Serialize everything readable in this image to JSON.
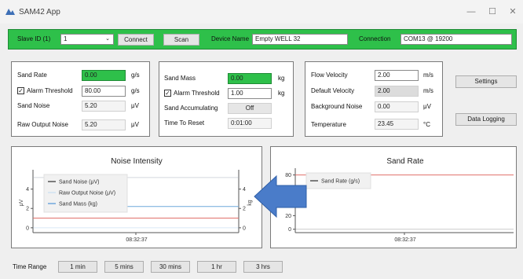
{
  "app": {
    "title": "SAM42 App",
    "window_controls": {
      "minimize": "—",
      "maximize": "☐",
      "close": "✕"
    }
  },
  "connection_bar": {
    "slave_id_label": "Slave ID (1)",
    "slave_id_value": "1",
    "connect_label": "Connect",
    "scan_label": "Scan",
    "device_name_label": "Device Name",
    "device_name_value": "Empty WELL 32",
    "connection_label": "Connection",
    "connection_value": "COM13 @ 19200",
    "accent_color": "#2ec04a"
  },
  "group1": {
    "sand_rate_label": "Sand Rate",
    "sand_rate_value": "0.00",
    "sand_rate_unit": "g/s",
    "alarm_threshold_label": "Alarm Threshold",
    "alarm_threshold_checked": true,
    "alarm_threshold_value": "80.00",
    "alarm_threshold_unit": "g/s",
    "sand_noise_label": "Sand Noise",
    "sand_noise_value": "5.20",
    "sand_noise_unit": "μV",
    "raw_output_noise_label": "Raw Output Noise",
    "raw_output_noise_value": "5.20",
    "raw_output_noise_unit": "μV"
  },
  "group2": {
    "sand_mass_label": "Sand Mass",
    "sand_mass_value": "0.00",
    "sand_mass_unit": "kg",
    "alarm_threshold_label": "Alarm Threshold",
    "alarm_threshold_checked": true,
    "alarm_threshold_value": "1.00",
    "alarm_threshold_unit": "kg",
    "sand_accumulating_label": "Sand Accumulating",
    "sand_accumulating_value": "Off",
    "time_to_reset_label": "Time To Reset",
    "time_to_reset_value": "0:01:00"
  },
  "group3": {
    "flow_velocity_label": "Flow Velocity",
    "flow_velocity_value": "2.00",
    "flow_velocity_unit": "m/s",
    "default_velocity_label": "Default Velocity",
    "default_velocity_value": "2.00",
    "default_velocity_unit": "m/s",
    "background_noise_label": "Background Noise",
    "background_noise_value": "0.00",
    "background_noise_unit": "μV",
    "temperature_label": "Temperature",
    "temperature_value": "23.45",
    "temperature_unit": "°C"
  },
  "side_buttons": {
    "settings_label": "Settings",
    "data_logging_label": "Data Logging"
  },
  "time_range": {
    "label": "Time Range",
    "options": [
      "1 min",
      "5 mins",
      "30 mins",
      "1 hr",
      "3 hrs"
    ]
  },
  "chart_data": [
    {
      "type": "line",
      "title": "Noise Intensity",
      "ylabel": "μV",
      "y2label": "kg",
      "ylim": [
        -0.5,
        6
      ],
      "yticks": [
        "0",
        "2",
        "4"
      ],
      "y2ticks": [
        "0",
        "2",
        "4"
      ],
      "xticks": [
        "08:32:37"
      ],
      "series": [
        {
          "name": "Sand Noise (μV)",
          "color": "#555555",
          "y": 5.2
        },
        {
          "name": "Raw Output Noise (μV)",
          "color": "#cfe3f3",
          "y": 5.2
        },
        {
          "name": "Sand Mass (kg)",
          "color": "#6fa8dc",
          "y": 0
        }
      ],
      "threshold": {
        "color": "#e0706a",
        "y": 1.0
      }
    },
    {
      "type": "line",
      "title": "Sand Rate",
      "ylim": [
        -5,
        90
      ],
      "yticks": [
        "0",
        "20",
        "80"
      ],
      "xticks": [
        "08:32:37"
      ],
      "series": [
        {
          "name": "Sand Rate (g/s)",
          "color": "#555555",
          "y": 0
        }
      ],
      "threshold": {
        "color": "#e0706a",
        "y": 80
      }
    }
  ],
  "overlay_arrow_color": "#4a7cc9"
}
